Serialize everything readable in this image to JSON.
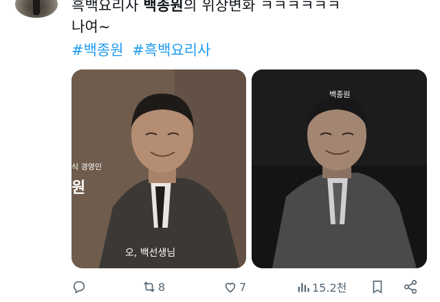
{
  "tweet": {
    "line1_prefix": "흑백요리사 ",
    "line1_bold": "백종원",
    "line1_suffix": "의 위상변화 ㅋㅋㅋㅋㅋㅋ",
    "line2": "나여~",
    "hashtags": [
      "#백종원",
      "#흑백요리사"
    ]
  },
  "media": {
    "left": {
      "caption_partial_top": "식 경영인",
      "caption_partial_big": "원",
      "subtitle": "오, 백선생님"
    },
    "right": {
      "name_tag": "백종원"
    }
  },
  "actions": {
    "reply_count": "",
    "retweet_count": "8",
    "like_count": "7",
    "views_count": "15.2천"
  },
  "icons": [
    "reply-icon",
    "retweet-icon",
    "like-icon",
    "views-icon",
    "bookmark-icon",
    "share-icon"
  ]
}
